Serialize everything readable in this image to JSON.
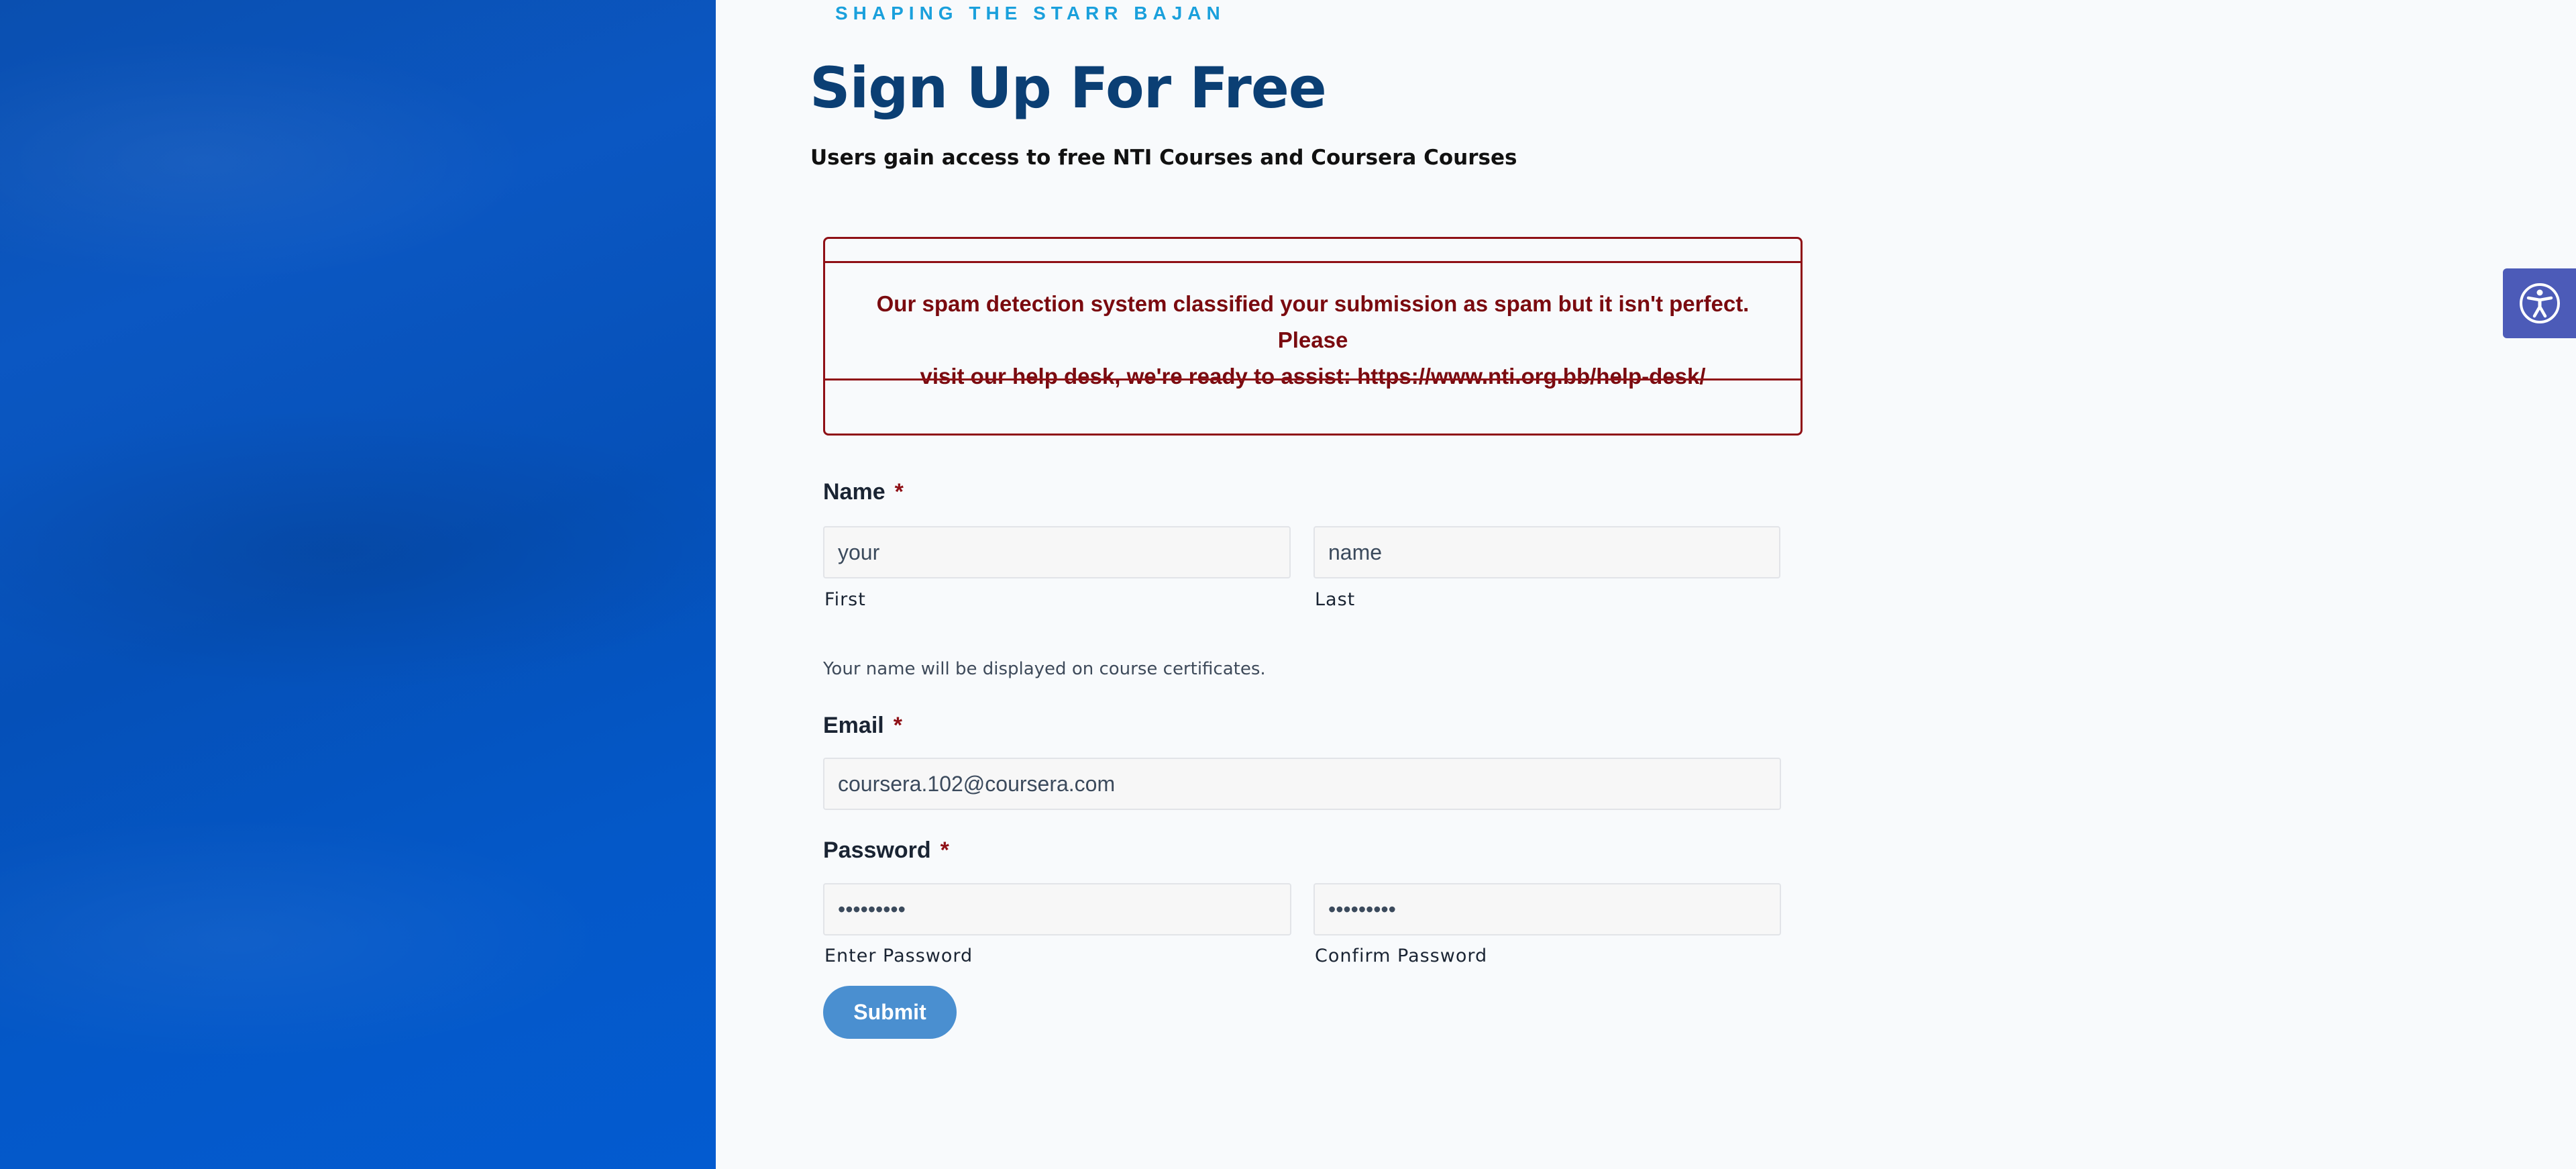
{
  "header": {
    "tagline": "SHAPING THE STARR BAJAN",
    "title": "Sign Up For Free",
    "subtitle": "Users gain access to free NTI Courses and Coursera Courses"
  },
  "alert": {
    "message_line1": "Our spam detection system classified your submission as spam but it isn't perfect. Please",
    "message_line2": "visit our help desk, we're ready to assist: https://www.nti.org.bb/help-desk/",
    "color": "#8f1016"
  },
  "form": {
    "name": {
      "label": "Name",
      "required": "*",
      "first_value": "your",
      "first_sublabel": "First",
      "last_value": "name",
      "last_sublabel": "Last",
      "help": "Your name will be displayed on course certificates."
    },
    "email": {
      "label": "Email",
      "required": "*",
      "value": "coursera.102@coursera.com"
    },
    "password": {
      "label": "Password",
      "required": "*",
      "enter_value": "•••••••••",
      "enter_sublabel": "Enter Password",
      "confirm_value": "•••••••••",
      "confirm_sublabel": "Confirm Password"
    },
    "submit_label": "Submit"
  },
  "accessibility": {
    "icon": "accessibility-icon",
    "color": "#4c5bb8"
  },
  "colors": {
    "title": "#0b3f74",
    "tagline": "#1aa0dc",
    "button": "#4a8fd0",
    "hero": "#0b57c2"
  }
}
